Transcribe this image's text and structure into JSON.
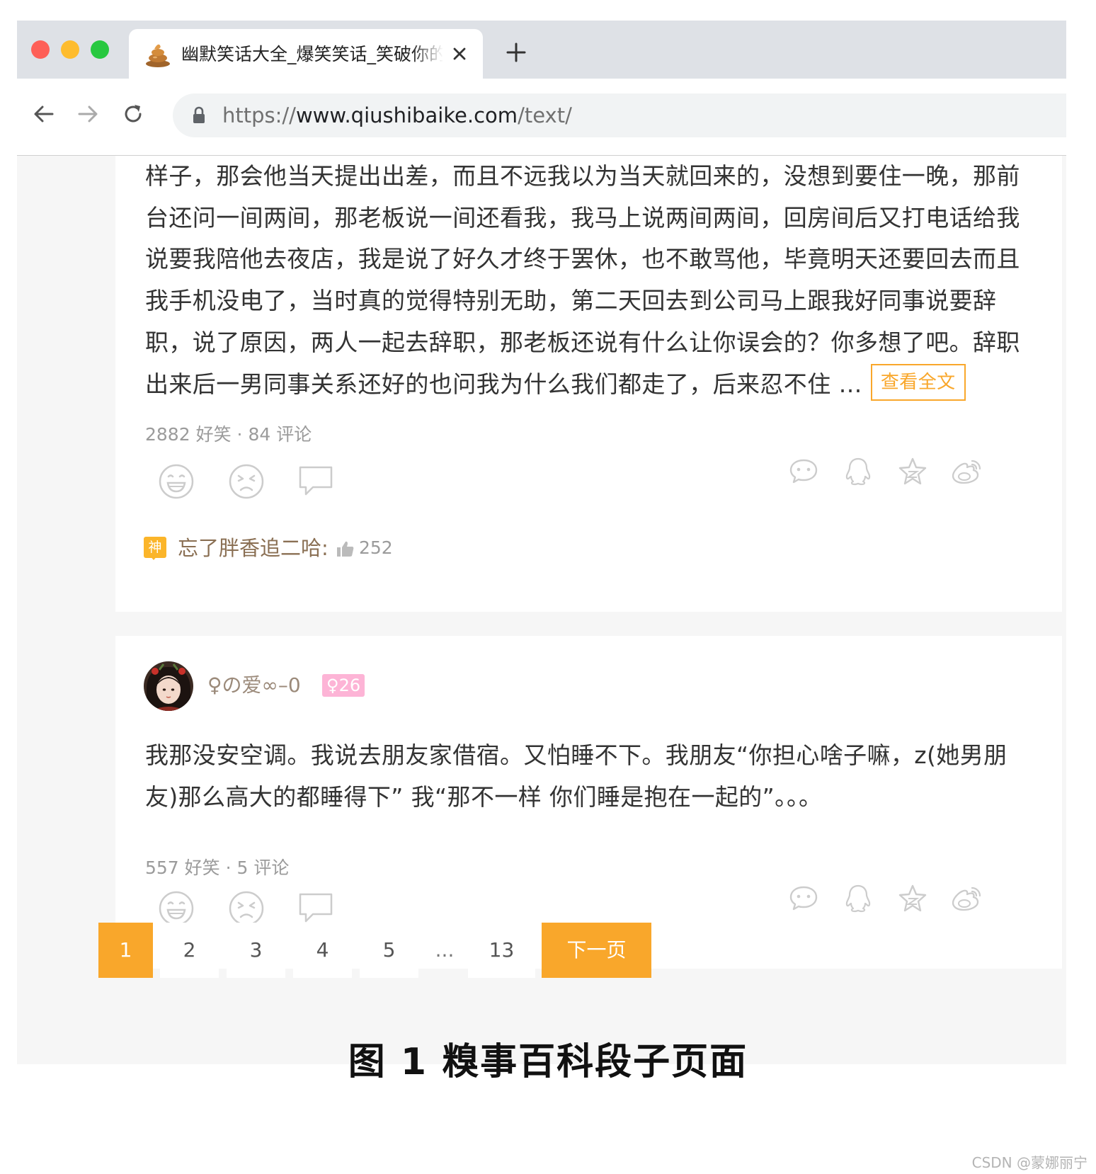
{
  "browser": {
    "tab_title": "幽默笑话大全_爆笑笑话_笑破你的肚子的搞笑段子 - 糗事百科",
    "url_scheme": "https://",
    "url_host": "www.qiushibaike.com",
    "url_path": "/text/"
  },
  "posts": [
    {
      "content_lines": [
        "样子，那会他当天提出出差，而且不远我以为当天就回来的，没想到要住一晚，那前",
        "台还问一间两间，那老板说一间还看我，我马上说两间两间，回房间后又打电话给我",
        "说要我陪他去夜店，我是说了好久才终于罢休，也不敢骂他，毕竟明天还要回去而且",
        "我手机没电了，当时真的觉得特别无助，第二天回去到公司马上跟我好同事说要辞",
        "职，说了原因，两人一起去辞职，那老板还说有什么让你误会的？你多想了吧。辞职",
        "出来后一男同事关系还好的也问我为什么我们都走了，后来忍不住 …"
      ],
      "view_full_label": "查看全文",
      "funny_count": "2882",
      "funny_label": "好笑",
      "separator": "·",
      "comment_count": "84",
      "comment_label": "评论",
      "god_comment": {
        "badge": "神",
        "username": "忘了胖香追二哈:",
        "likes": "252"
      }
    },
    {
      "username": "♀の爱∞–0",
      "age_badge": "♀26",
      "content_lines": [
        "我那没安空调。我说去朋友家借宿。又怕睡不下。我朋友“你担心啥子嘛，z(她男朋",
        "友)那么高大的都睡得下” 我“那不一样 你们睡是抱在一起的”。。。"
      ],
      "funny_count": "557",
      "funny_label": "好笑",
      "separator": "·",
      "comment_count": "5",
      "comment_label": "评论"
    }
  ],
  "pagination": {
    "pages": [
      "1",
      "2",
      "3",
      "4",
      "5"
    ],
    "ellipsis": "...",
    "last_page": "13",
    "next_label": "下一页",
    "current": "1"
  },
  "caption": "图 1  糗事百科段子页面",
  "watermark": "CSDN @蒙娜丽宁",
  "colors": {
    "accent": "#f9a72b",
    "icon_gray": "#cccccc",
    "username_brown": "#8a6f53",
    "age_badge_pink": "#fdb4d6"
  },
  "icons": {
    "favicon": "poop-icon",
    "reactions": [
      "smile-face-icon",
      "frown-face-icon",
      "comment-bubble-icon"
    ],
    "share": [
      "wechat-icon",
      "qq-icon",
      "qzone-star-icon",
      "weibo-icon"
    ]
  }
}
